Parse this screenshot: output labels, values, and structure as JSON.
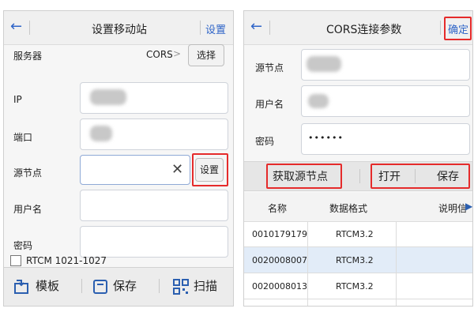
{
  "left": {
    "back_icon": "←",
    "title": "设置移动站",
    "settings_label": "设置",
    "server_label": "服务器",
    "server_value": "CORS",
    "server_chevron": ">",
    "select_button": "选择",
    "ip_label": "IP",
    "port_label": "端口",
    "mount_label": "源节点",
    "clear_icon": "✕",
    "set_button": "设置",
    "user_label": "用户名",
    "password_label": "密码",
    "rtcm_label": "RTCM 1021-1027",
    "toolbar": {
      "template": "模板",
      "save": "保存",
      "scan": "扫描"
    }
  },
  "right": {
    "back_icon": "←",
    "title": "CORS连接参数",
    "confirm_label": "确定",
    "mount_label": "源节点",
    "user_label": "用户名",
    "password_label": "密码",
    "password_value": "••••••",
    "get_mount_button": "获取源节点",
    "open_button": "打开",
    "save_button": "保存",
    "table": {
      "headers": [
        "名称",
        "数据格式",
        "说明信"
      ],
      "rows": [
        {
          "name": "0010179179",
          "format": "RTCM3.2"
        },
        {
          "name": "0020008007",
          "format": "RTCM3.2"
        },
        {
          "name": "0020008013",
          "format": "RTCM3.2"
        }
      ]
    }
  },
  "colors": {
    "accent": "#2f65c8",
    "highlight": "#e52b2b",
    "selected_row": "#e2ecf8"
  }
}
